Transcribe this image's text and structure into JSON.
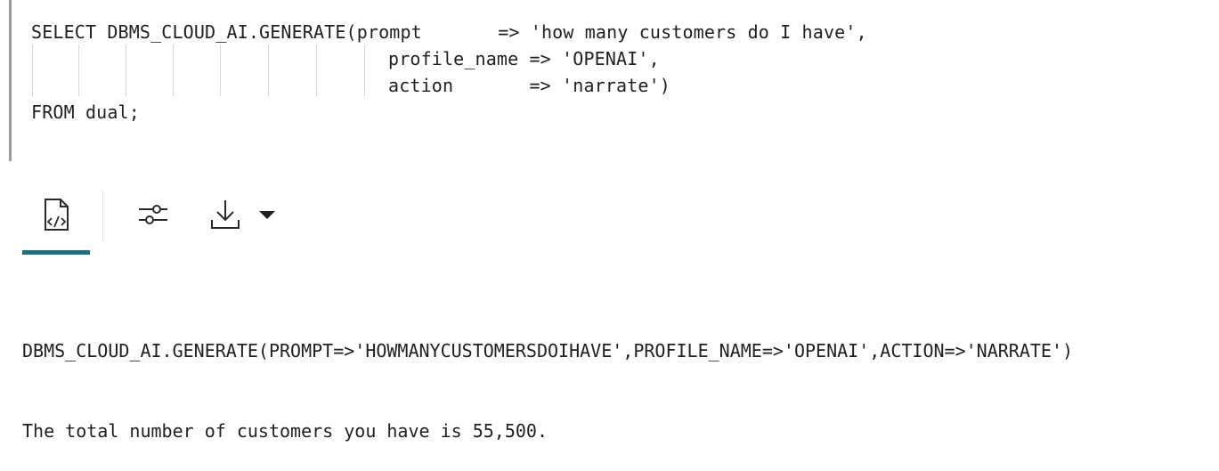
{
  "editor": {
    "lines": [
      "SELECT DBMS_CLOUD_AI.GENERATE(prompt       => 'how many customers do I have',",
      "profile_name => 'OPENAI',",
      "action       => 'narrate')",
      "FROM dual;"
    ]
  },
  "toolbar": {
    "buttons": [
      {
        "icon": "script-output-icon",
        "active": true
      },
      {
        "icon": "query-settings-icon",
        "active": false
      },
      {
        "icon": "download-icon",
        "active": false
      },
      {
        "icon": "dropdown-caret-icon",
        "active": false
      }
    ],
    "accent_color": "#1d6e8c"
  },
  "output": {
    "lines": [
      "DBMS_CLOUD_AI.GENERATE(PROMPT=>'HOWMANYCUSTOMERSDOIHAVE',PROFILE_NAME=>'OPENAI',ACTION=>'NARRATE')",
      "The total number of customers you have is 55,500."
    ]
  }
}
